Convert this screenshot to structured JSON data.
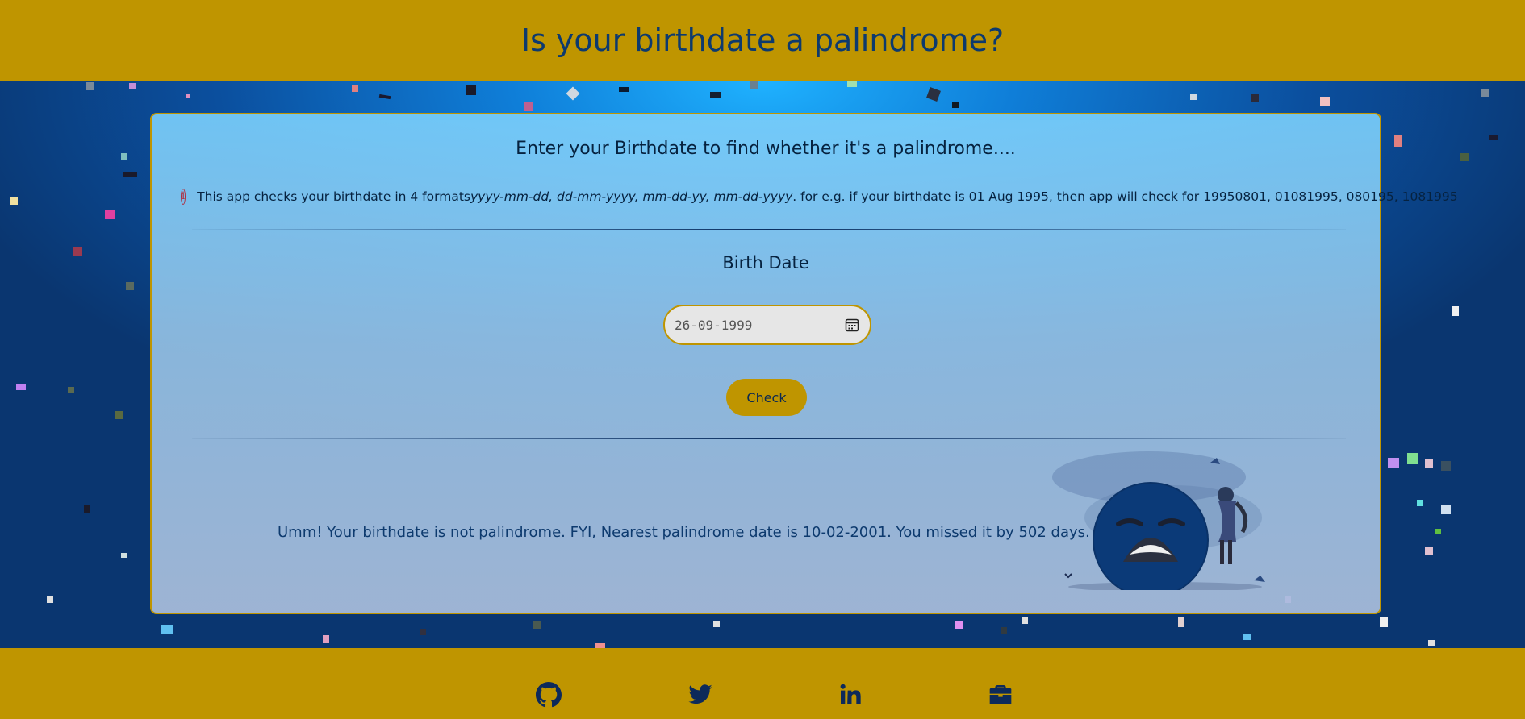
{
  "header": {
    "title": "Is your birthdate a palindrome?"
  },
  "card": {
    "heading": "Enter your Birthdate to find whether it's a palindrome....",
    "info": {
      "icon": "info-circle-icon",
      "prefix": "This app checks your birthdate in 4 formats ",
      "formats": "yyyy-mm-dd, dd-mm-yyyy, mm-dd-yy, mm-dd-yyyy",
      "suffix": ". for e.g. if your birthdate is 01 Aug 1995, then app will check for 19950801, 01081995, 080195, 1081995"
    },
    "birth_date_label": "Birth Date",
    "birth_date_value": "26-09-1999",
    "check_button": "Check",
    "result_message": "Umm! Your birthdate is not palindrome. FYI, Nearest palindrome date is 10-02-2001. You missed it by 502 days."
  },
  "footer": {
    "links": [
      "github-icon",
      "twitter-icon",
      "linkedin-icon",
      "briefcase-icon"
    ]
  },
  "colors": {
    "accent": "#bf9500",
    "text": "#0d3a6e",
    "info_icon": "#b02a3b"
  }
}
